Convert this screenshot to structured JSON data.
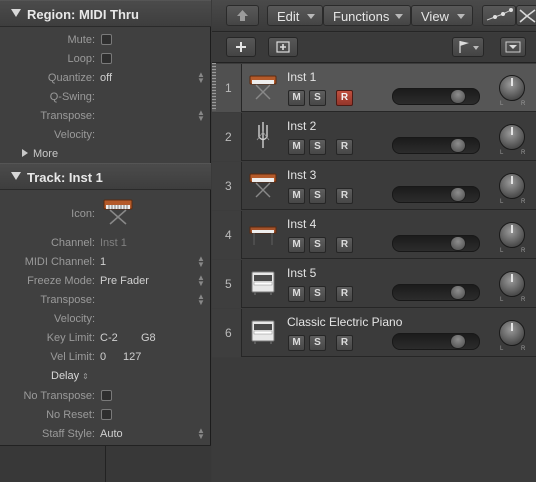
{
  "region": {
    "title": "Region: MIDI Thru",
    "mute_label": "Mute:",
    "loop_label": "Loop:",
    "quantize_label": "Quantize:",
    "quantize_value": "off",
    "qswing_label": "Q-Swing:",
    "transpose_label": "Transpose:",
    "velocity_label": "Velocity:",
    "more_label": "More"
  },
  "track_section": {
    "title": "Track:  Inst 1",
    "icon_label": "Icon:",
    "channel_label": "Channel:",
    "channel_value": "Inst 1",
    "midi_channel_label": "MIDI Channel:",
    "midi_channel_value": "1",
    "freeze_label": "Freeze Mode:",
    "freeze_value": "Pre Fader",
    "transpose_label": "Transpose:",
    "velocity_label": "Velocity:",
    "keylimit_label": "Key Limit:",
    "keylimit_low": "C-2",
    "keylimit_high": "G8",
    "vellimit_label": "Vel Limit:",
    "vellimit_low": "0",
    "vellimit_high": "127",
    "delay_label": "Delay",
    "no_transpose_label": "No Transpose:",
    "no_reset_label": "No Reset:",
    "staff_style_label": "Staff Style:",
    "staff_style_value": "Auto"
  },
  "toolbar": {
    "edit": "Edit",
    "functions": "Functions",
    "view": "View"
  },
  "tracks": [
    {
      "num": "1",
      "name": "Inst 1",
      "icon": "synth-keyboard-icon",
      "armed": true
    },
    {
      "num": "2",
      "name": "Inst 2",
      "icon": "tuning-fork-icon",
      "armed": false
    },
    {
      "num": "3",
      "name": "Inst 3",
      "icon": "synth-keyboard-icon",
      "armed": false
    },
    {
      "num": "4",
      "name": "Inst 4",
      "icon": "electric-piano-icon",
      "armed": false
    },
    {
      "num": "5",
      "name": "Inst 5",
      "icon": "upright-piano-icon",
      "armed": false
    },
    {
      "num": "6",
      "name": "Classic Electric Piano",
      "icon": "upright-piano-icon",
      "armed": false
    }
  ],
  "buttons": {
    "m": "M",
    "s": "S",
    "r": "R"
  },
  "pan": {
    "l": "L",
    "r": "R"
  },
  "colors": {
    "record_armed": "#b8473a",
    "selected_track": "#565656"
  }
}
